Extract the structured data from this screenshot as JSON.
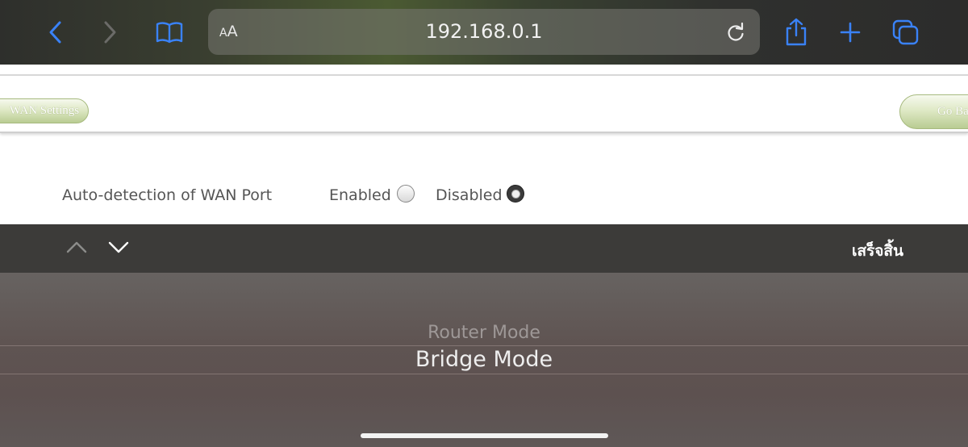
{
  "browser": {
    "aa_small": "A",
    "aa_big": "A",
    "url": "192.168.0.1",
    "icons": [
      "back-icon",
      "forward-icon",
      "bookmarks-icon",
      "reload-icon",
      "share-icon",
      "new-tab-icon",
      "tabs-icon"
    ],
    "accent": "#3a82f7"
  },
  "page": {
    "wan_button": "WAN Settings",
    "go_back_button": "Go Back",
    "auto_detect_label": "Auto-detection of WAN Port",
    "option_enabled": "Enabled",
    "option_disabled": "Disabled",
    "selected_option": "Disabled",
    "button_color": "#c9d9a6"
  },
  "keyboard_accessory": {
    "done_label": "เสร็จสิ้น",
    "icons": [
      "chevron-up-icon",
      "chevron-down-icon"
    ]
  },
  "picker": {
    "options": [
      "Router Mode",
      "Bridge Mode"
    ],
    "selected": "Bridge Mode"
  }
}
